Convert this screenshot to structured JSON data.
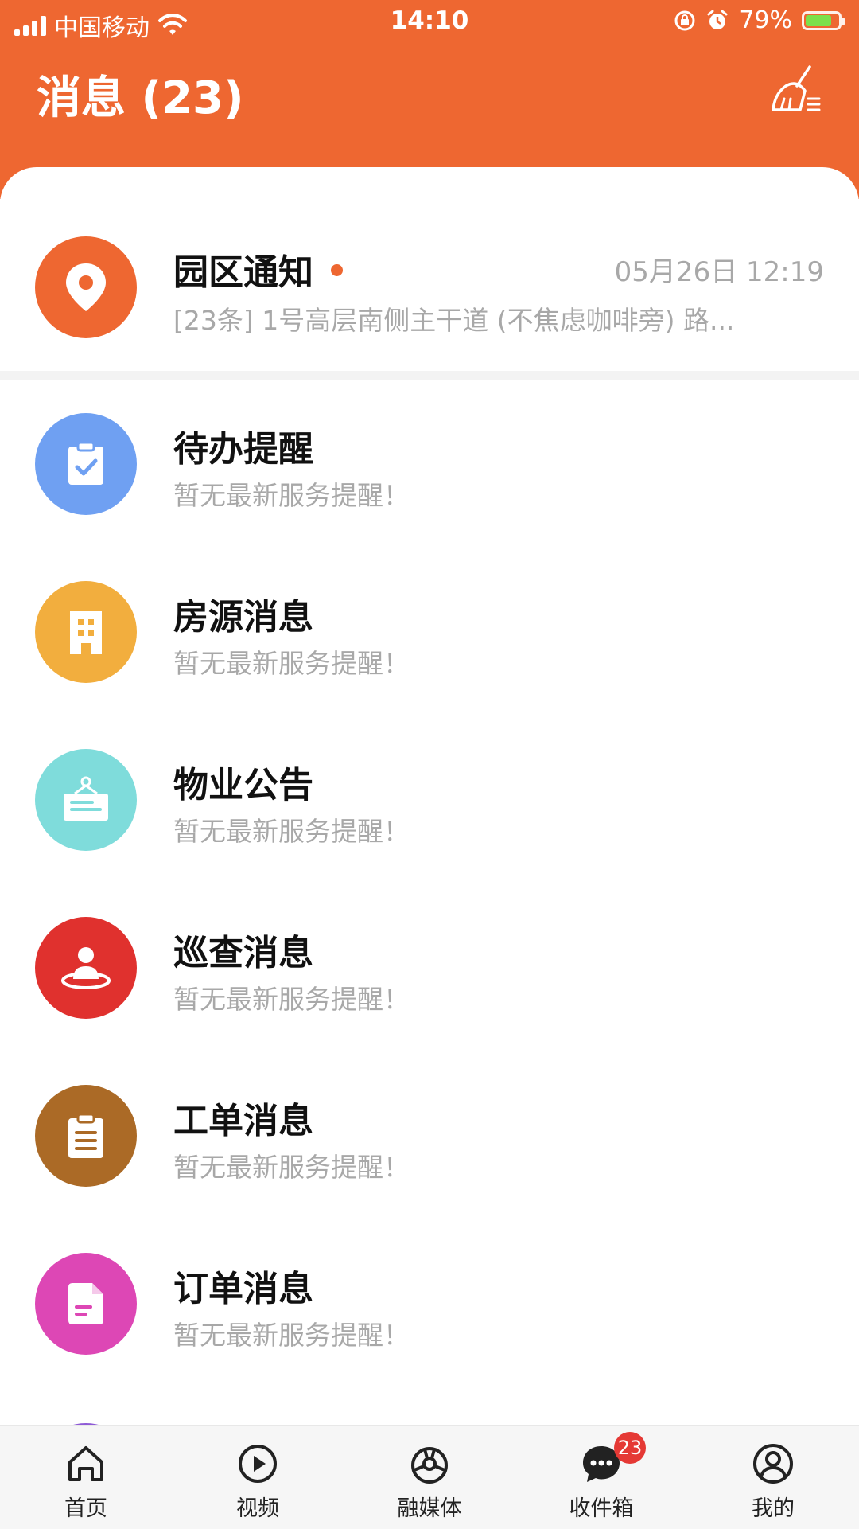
{
  "status_bar": {
    "carrier": "中国移动",
    "time": "14:10",
    "battery_text": "79%",
    "battery_level": 0.79
  },
  "header": {
    "title": "消息 (23)",
    "clear_icon": "broom-icon"
  },
  "notice": {
    "title": "园区通知",
    "time": "05月26日 12:19",
    "preview": "[23条] 1号高层南侧主干道 (不焦虑咖啡旁) 路...",
    "icon": "location-pin-icon",
    "color": "#EE6731",
    "unread": true
  },
  "messages": [
    {
      "title": "待办提醒",
      "subtitle": "暂无最新服务提醒！",
      "icon": "clipboard-check-icon",
      "color": "#6FA0F2"
    },
    {
      "title": "房源消息",
      "subtitle": "暂无最新服务提醒！",
      "icon": "building-icon",
      "color": "#F2AE3E"
    },
    {
      "title": "物业公告",
      "subtitle": "暂无最新服务提醒！",
      "icon": "notice-board-icon",
      "color": "#7FDCDB"
    },
    {
      "title": "巡查消息",
      "subtitle": "暂无最新服务提醒！",
      "icon": "patrol-person-icon",
      "color": "#E0312E"
    },
    {
      "title": "工单消息",
      "subtitle": "暂无最新服务提醒！",
      "icon": "work-order-icon",
      "color": "#AB6A26"
    },
    {
      "title": "订单消息",
      "subtitle": "暂无最新服务提醒！",
      "icon": "order-document-icon",
      "color": "#DD47B5"
    }
  ],
  "tabbar": {
    "items": [
      {
        "label": "首页",
        "icon": "home-icon"
      },
      {
        "label": "视频",
        "icon": "play-icon"
      },
      {
        "label": "融媒体",
        "icon": "media-icon"
      },
      {
        "label": "收件箱",
        "icon": "chat-bubble-icon",
        "badge": "23",
        "active": true
      },
      {
        "label": "我的",
        "icon": "user-icon"
      }
    ]
  }
}
